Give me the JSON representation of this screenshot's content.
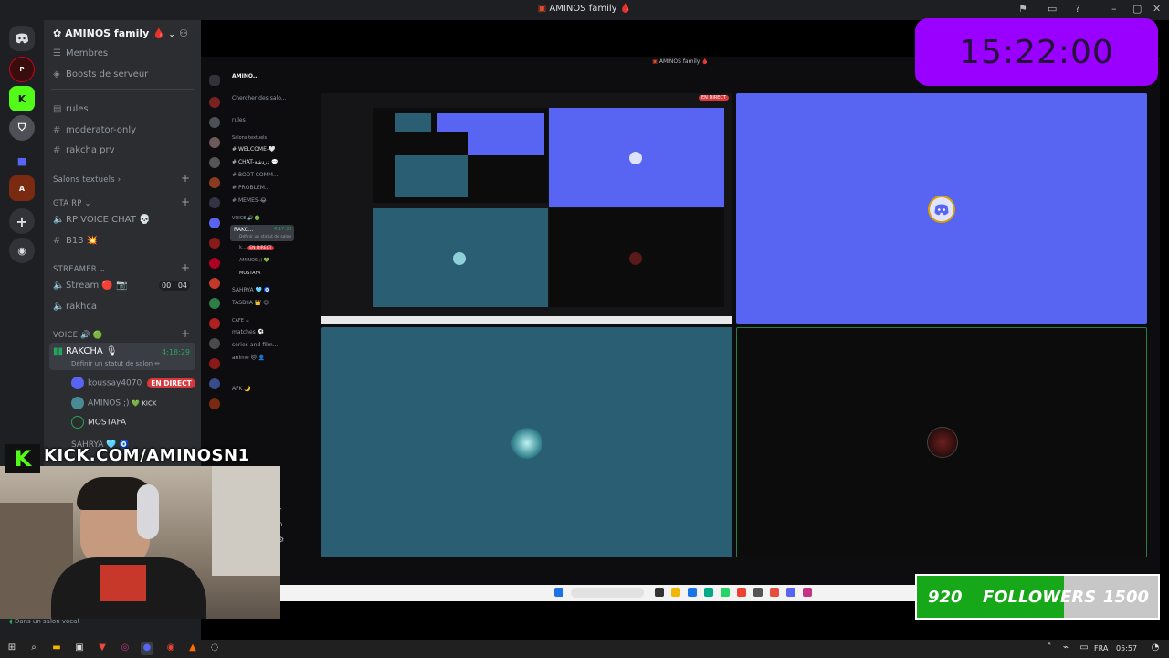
{
  "window": {
    "title": "AMINOS family",
    "title_emoji": "🩸"
  },
  "server": {
    "name": "AMINOS family",
    "name_emoji": "🩸"
  },
  "sidebar": {
    "top_items": [
      {
        "label": "Membres",
        "icon": "members-icon"
      },
      {
        "label": "Boosts de serveur",
        "icon": "boost-icon"
      }
    ],
    "channels": [
      {
        "label": "rules",
        "icon": "rules-icon"
      },
      {
        "label": "moderator-only",
        "icon": "hash-icon"
      },
      {
        "label": "rakcha prv",
        "icon": "hash-icon"
      }
    ],
    "cat_text": "Salons textuels",
    "cat_gta": "GTA RP",
    "gta_channels": [
      {
        "label": "RP VOICE CHAT 💀",
        "icon": "speaker-icon"
      },
      {
        "label": "B13 💥",
        "icon": "hash-icon"
      }
    ],
    "cat_streamer": "STREAMER",
    "stream_label": "Stream 🔴 📷",
    "stream_count_a": "00",
    "stream_count_b": "04",
    "rakhca": "rakhca",
    "cat_voice": "VOICE 🔊 🟢",
    "voice_channel": "RAKCHA 🎙",
    "voice_time": "4:18:29",
    "voice_status": "Définir un statut de salon ✏",
    "users": [
      {
        "name": "koussay4070",
        "live": "EN DIRECT"
      },
      {
        "name": "AMINOS ;)",
        "tag": "💚 KICK"
      },
      {
        "name": "MOSTAFA"
      }
    ],
    "last_item": "SAHRYA 🩵 🧿",
    "footer_text": "Dans un salon vocal"
  },
  "nested": {
    "title": "AMINOS family",
    "server": "AMINO...",
    "search": "Chercher des salo...",
    "rules": "rules",
    "cat": "Salons textuels",
    "channels": [
      "WELCOME-🤍",
      "CHAT-دردشة 💬",
      "BOOT-COMM...",
      "PROBLEM...",
      "MEMES-😂"
    ],
    "voice_cat": "VOICE 🔊 🟢",
    "voice": "RAKC...",
    "voice_time": "4:17:33",
    "voice_status": "Définir un statut de salon",
    "users": [
      "k...",
      "AMINOS ;) 💚",
      "MOSTAFA"
    ],
    "live": "EN DIRECT",
    "after": [
      "SAHRYA 🩵 🧿",
      "TASBIIA 👑 😊"
    ],
    "cafe": "CAFE ☕",
    "cafe_channels": [
      "matches ⚽",
      "series-and-film...",
      "anime 🐱 👤"
    ],
    "afk": "AFK 🌙",
    "in_live_badge": "EN DIRECT"
  },
  "timer": {
    "text": "15:22:00"
  },
  "kick": {
    "letter": "K",
    "url": "KICK.COM/AMINOSN1"
  },
  "followers": {
    "current": 920,
    "label": "FOLLOWERS",
    "goal": 1500,
    "progress": 0.61
  },
  "taskbar": {
    "lang": "FRA",
    "time": "05:57"
  },
  "colors": {
    "blurple": "#5865f2",
    "teal": "#2a5f73",
    "timer_bg": "#9a00ff",
    "followers_fill": "#17a81a",
    "live_red": "#da373c"
  }
}
